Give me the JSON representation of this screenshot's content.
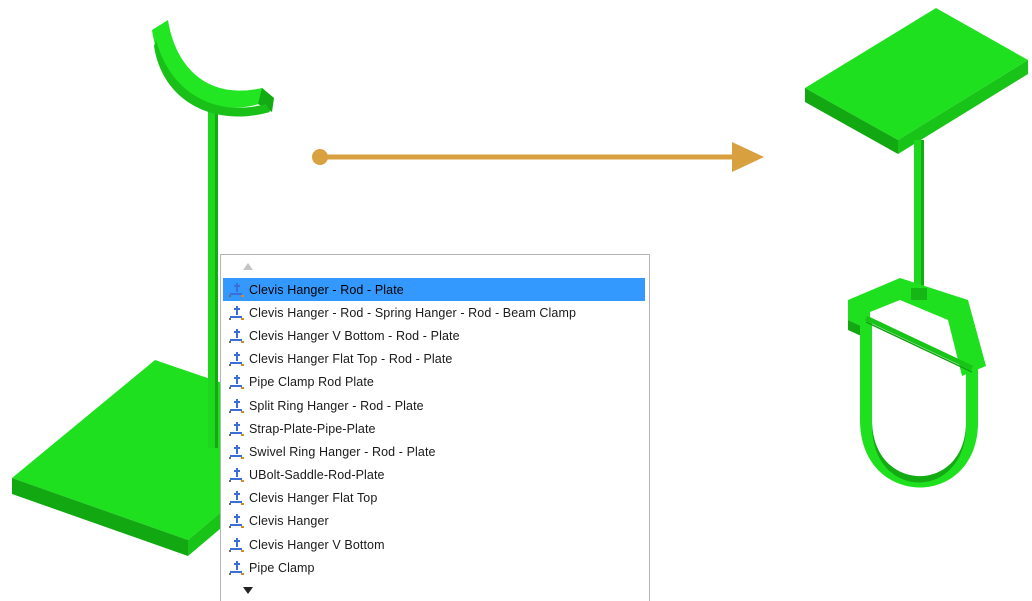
{
  "colors": {
    "model_green": "#1fe01f",
    "model_green_shade": "#16b616",
    "arrow": "#d9a040",
    "selection": "#3399ff"
  },
  "dropdown": {
    "scroll_up_icon": "triangle-up-icon",
    "scroll_down_icon": "triangle-down-icon",
    "items": [
      {
        "label": "Clevis Hanger - Rod - Plate",
        "selected": true,
        "icon": "hanger-assembly-icon"
      },
      {
        "label": "Clevis Hanger - Rod - Spring Hanger - Rod - Beam Clamp",
        "selected": false,
        "icon": "hanger-assembly-icon"
      },
      {
        "label": "Clevis Hanger V Bottom - Rod - Plate",
        "selected": false,
        "icon": "hanger-assembly-icon"
      },
      {
        "label": "Clevis Hanger Flat Top - Rod - Plate",
        "selected": false,
        "icon": "hanger-assembly-icon"
      },
      {
        "label": "Pipe Clamp Rod Plate",
        "selected": false,
        "icon": "hanger-assembly-icon"
      },
      {
        "label": "Split Ring Hanger - Rod - Plate",
        "selected": false,
        "icon": "hanger-assembly-icon"
      },
      {
        "label": "Strap-Plate-Pipe-Plate",
        "selected": false,
        "icon": "hanger-assembly-icon"
      },
      {
        "label": "Swivel Ring Hanger - Rod - Plate",
        "selected": false,
        "icon": "hanger-assembly-icon"
      },
      {
        "label": "UBolt-Saddle-Rod-Plate",
        "selected": false,
        "icon": "hanger-assembly-icon"
      },
      {
        "label": "Clevis Hanger Flat Top",
        "selected": false,
        "icon": "hanger-assembly-icon"
      },
      {
        "label": "Clevis Hanger",
        "selected": false,
        "icon": "hanger-assembly-icon"
      },
      {
        "label": "Clevis Hanger V Bottom",
        "selected": false,
        "icon": "hanger-assembly-icon"
      },
      {
        "label": "Pipe Clamp",
        "selected": false,
        "icon": "hanger-assembly-icon"
      }
    ]
  }
}
